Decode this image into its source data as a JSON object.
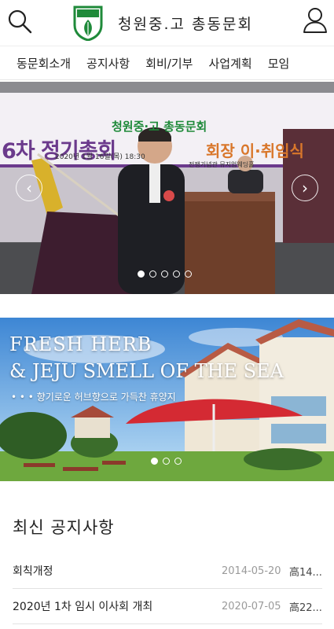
{
  "header": {
    "logo_emblem_text": "청원",
    "logo_text": "청원중.고 총동문회"
  },
  "nav": {
    "items": [
      "동문회소개",
      "공지사항",
      "회비/기부",
      "사업계획",
      "모임"
    ]
  },
  "slider1": {
    "banner_org": "청원중·고 총동문회",
    "banner_main": "6차 정기총회",
    "banner_main_right": "회장 이·취임식",
    "banner_date": "2020년 1월 16일(목) 18:30",
    "banner_place": "전쟁기념관 뮤지엄웨딩홀",
    "slide_count": 5,
    "active_index": 0
  },
  "slider2": {
    "headline_1": "FRESH HERB",
    "headline_2": "& JEJU SMELL OF THE SEA",
    "subline": "• • • 향기로운 허브향으로 가득찬 휴양지",
    "slide_count": 3,
    "active_index": 0
  },
  "notices": {
    "title": "최신 공지사항",
    "rows": [
      {
        "title": "회칙개정",
        "date": "2014-05-20",
        "author": "高14..."
      },
      {
        "title": "2020년 1차 임시 이사회 개최",
        "date": "2020-07-05",
        "author": "高22..."
      }
    ]
  },
  "colors": {
    "brand_green": "#1f8a3a",
    "banner_purple": "#6b3a8c",
    "banner_orange": "#d9772b"
  }
}
